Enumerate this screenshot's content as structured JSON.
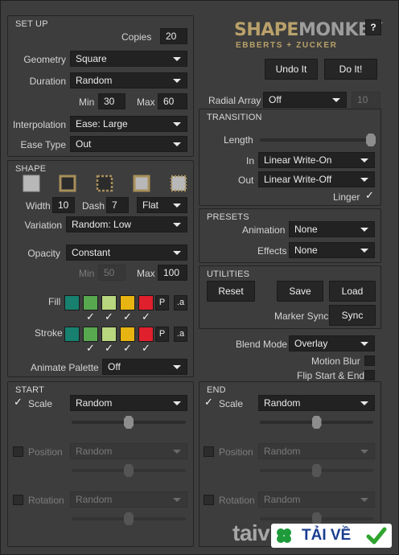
{
  "logo": {
    "part1": "SHAPE",
    "part2": "MONKEY",
    "sub": "EBBERTS + ZUCKER",
    "help": "?"
  },
  "setup": {
    "title": "SET UP",
    "copies_label": "Copies",
    "copies": "20",
    "geometry_label": "Geometry",
    "geometry": "Square",
    "duration_label": "Duration",
    "duration": "Random",
    "min_label": "Min",
    "min": "30",
    "max_label": "Max",
    "max": "60",
    "interp_label": "Interpolation",
    "interp": "Ease: Large",
    "easetype_label": "Ease Type",
    "easetype": "Out"
  },
  "actions": {
    "undo": "Undo It",
    "do": "Do It!"
  },
  "radial": {
    "label": "Radial Array",
    "value": "Off",
    "count": "10"
  },
  "transition": {
    "title": "TRANSITION",
    "length_label": "Length",
    "length_level": 1.0,
    "in_label": "In",
    "in": "Linear Write-On",
    "out_label": "Out",
    "out": "Linear Write-Off",
    "linger_label": "Linger",
    "linger": true
  },
  "shape": {
    "title": "SHAPE",
    "icons": [
      "solid-square-icon",
      "outline-square-icon",
      "dashed-square-icon",
      "filled-outline-square-icon",
      "dotted-filled-square-icon"
    ],
    "width_label": "Width",
    "width": "10",
    "dash_label": "Dash",
    "dash": "7",
    "cap": "Flat",
    "variation_label": "Variation",
    "variation": "Random: Low",
    "opacity_label": "Opacity",
    "opacity": "Constant",
    "omin_label": "Min",
    "omin": "50",
    "omax_label": "Max",
    "omax": "100",
    "fill_label": "Fill",
    "stroke_label": "Stroke",
    "palette_p": "P",
    "palette_a": ".a",
    "colors": [
      "#17806f",
      "#58a84f",
      "#b8d67e",
      "#e8b412",
      "#e0202c"
    ],
    "anim_palette_label": "Animate Palette",
    "anim_palette": "Off"
  },
  "presets": {
    "title": "PRESETS",
    "anim_label": "Animation",
    "anim": "None",
    "effects_label": "Effects",
    "effects": "None"
  },
  "utilities": {
    "title": "UTILITIES",
    "reset": "Reset",
    "save": "Save",
    "load": "Load",
    "marker_label": "Marker Sync",
    "sync": "Sync"
  },
  "blend": {
    "label": "Blend Mode",
    "value": "Overlay",
    "motion_blur": "Motion Blur",
    "flip": "Flip Start & End"
  },
  "start": {
    "title": "START",
    "scale_label": "Scale",
    "scale": "Random",
    "scale_level": 0.5,
    "position_label": "Position",
    "position": "Random",
    "position_level": 0.5,
    "rotation_label": "Rotation",
    "rotation": "Random",
    "rotation_level": 0.5
  },
  "end": {
    "title": "END",
    "scale_label": "Scale",
    "scale": "Random",
    "scale_level": 0.5,
    "position_label": "Position",
    "position": "Random",
    "position_level": 0.5,
    "rotation_label": "Rotation",
    "rotation": "Random",
    "rotation_level": 0.5
  },
  "watermark": {
    "text1": "taiv",
    "text2": "TẢI VỀ"
  }
}
